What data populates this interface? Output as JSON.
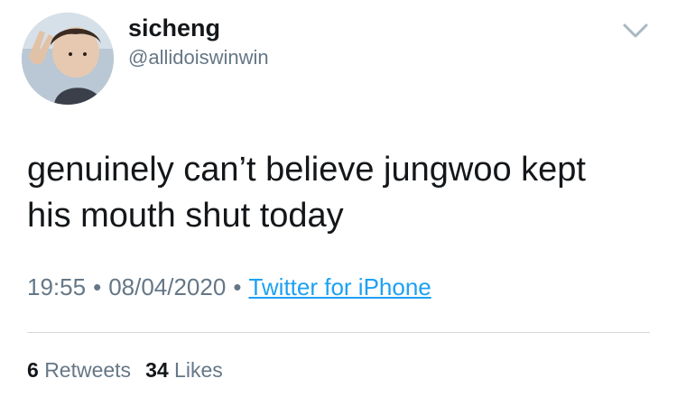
{
  "user": {
    "display_name": "sicheng",
    "handle": "@allidoiswinwin"
  },
  "tweet": {
    "text_line1": "genuinely can’t believe jungwoo kept",
    "text_line2": "his mouth shut today"
  },
  "meta": {
    "time": "19:55",
    "separator": "•",
    "date": "08/04/2020",
    "source": "Twitter for iPhone"
  },
  "stats": {
    "retweets_count": "6",
    "retweets_label": "Retweets",
    "likes_count": "34",
    "likes_label": "Likes"
  },
  "icons": {
    "menu": "chevron-down-icon"
  },
  "colors": {
    "text": "#14171a",
    "secondary": "#657786",
    "link": "#1da1f2",
    "divider": "#d6d9db"
  }
}
